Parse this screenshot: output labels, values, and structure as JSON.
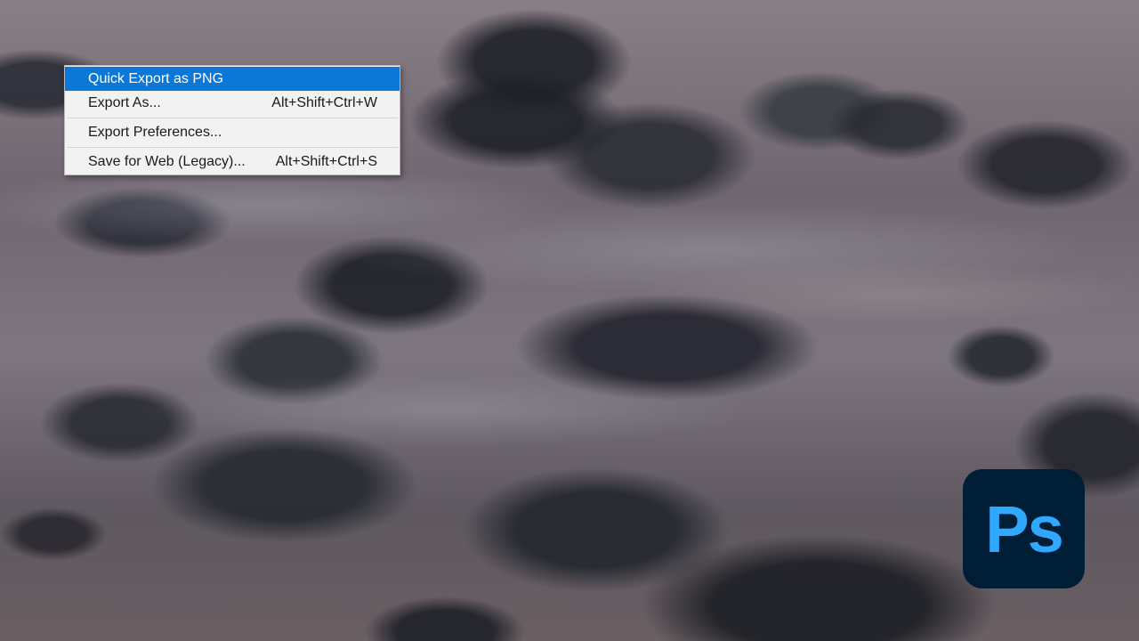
{
  "menu": {
    "items": [
      {
        "label": "Quick Export as PNG",
        "shortcut": ""
      },
      {
        "label": "Export As...",
        "shortcut": "Alt+Shift+Ctrl+W"
      },
      {
        "label": "Export Preferences...",
        "shortcut": ""
      },
      {
        "label": "Save for Web (Legacy)...",
        "shortcut": "Alt+Shift+Ctrl+S"
      }
    ],
    "highlight_color": "#0b78d7"
  },
  "logo": {
    "text": "Ps",
    "background": "#001e36",
    "color": "#31a8ff"
  }
}
